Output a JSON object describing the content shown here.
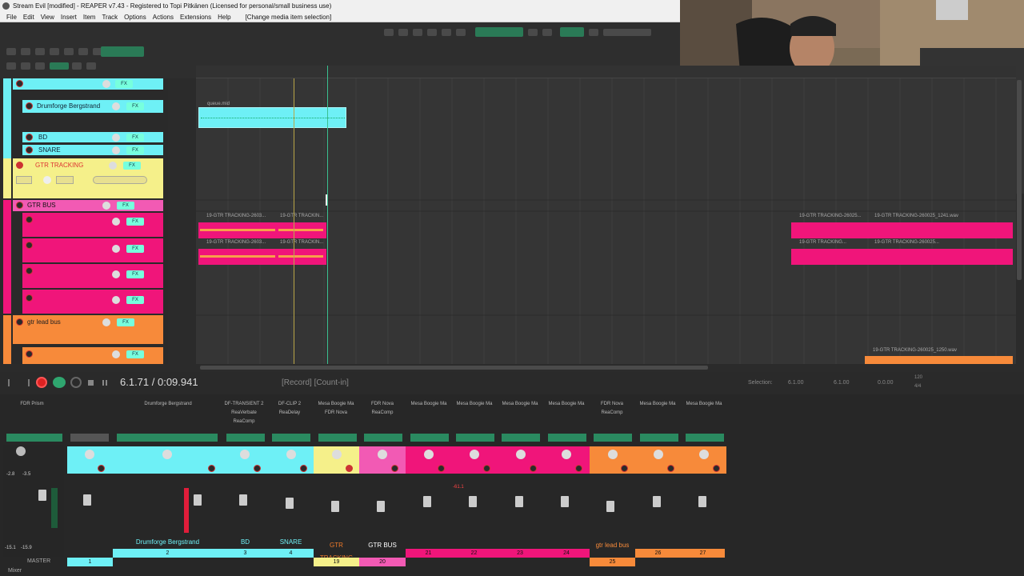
{
  "window": {
    "title": "Stream Evil [modified] - REAPER v7.43 - Registered to Topi Pitkänen (Licensed for personal/small business use)"
  },
  "menu": [
    "File",
    "Edit",
    "View",
    "Insert",
    "Item",
    "Track",
    "Options",
    "Actions",
    "Extensions",
    "Help",
    "[Change media item selection]"
  ],
  "tracks": {
    "drumforge": "Drumforge Bergstrand",
    "bd": "BD",
    "snare": "SNARE",
    "gtr_tracking": "GTR TRACKING",
    "gtr_bus": "GTR BUS",
    "gtr_lead_bus": "gtr lead bus",
    "fx_label": "FX"
  },
  "items": {
    "midi": "queue.mid",
    "gtr1a": "19-GTR TRACKING-2603...",
    "gtr1b": "19-GTR TRACKIN...",
    "gtr2a": "19-GTR TRACKING-2603...",
    "gtr2b": "19-GTR TRACKIN...",
    "right1a": "19-GTR TRACKING-26025...",
    "right1b": "19-GTR TRACKING-260025_1241.wav",
    "right2a": "19-GTR TRACKING...",
    "right2b": "19-GTR TRACKING-260025...",
    "bottom": "19-GTR TRACKING-260025_1250.wav"
  },
  "transport": {
    "time": "6.1.71 / 0:09.941",
    "status": "[Record] [Count-in]",
    "selection_label": "Selection:",
    "sel_start": "6.1.00",
    "sel_end": "6.1.00",
    "sel_len": "0.0.00",
    "bpm": "120",
    "sig": "4/4"
  },
  "mixer": {
    "fx_names": [
      "FDR Prism",
      "Drumforge Bergstrand",
      "DF-TRANSIENT 2\nReaVerbate\nReaComp",
      "DF-CLIP 2\nReaDelay",
      "Mesa Boogie Ma\nFDR Nova",
      "FDR Nova\nReaComp",
      "Mesa Boogie Ma",
      "Mesa Boogie Ma",
      "Mesa Boogie Ma",
      "Mesa Boogie Ma",
      "FDR Nova\nReaComp",
      "Mesa Boogie Ma",
      "Mesa Boogie Ma"
    ],
    "master_label": "MASTER",
    "mixer_tab": "Mixer",
    "master_peak_l": "-15.1",
    "master_peak_r": "-15.9",
    "master_vol_l": "-2.8",
    "master_vol_r": "-3.5",
    "labels": {
      "drumforge": "Drumforge Bergstrand",
      "bd": "BD",
      "snare": "SNARE",
      "gtr_tracking": "GTR TRACKING",
      "gtr_bus": "GTR BUS",
      "gtr_lead_bus": "gtr lead bus"
    },
    "numbers": {
      "n1": "1",
      "n2": "2",
      "n3": "3",
      "n4": "4",
      "n19": "19",
      "n20": "20",
      "n21": "21",
      "n22": "22",
      "n23": "23",
      "n24": "24",
      "n25": "25",
      "n26": "26",
      "n27": "27"
    },
    "clip_value": "-61.1"
  },
  "colors": {
    "cyan": "#6ef0f6",
    "yellow": "#f5f08a",
    "magenta": "#f0157a",
    "pink": "#f25ab4",
    "orange": "#f78a3a",
    "green": "#2a8a60"
  }
}
